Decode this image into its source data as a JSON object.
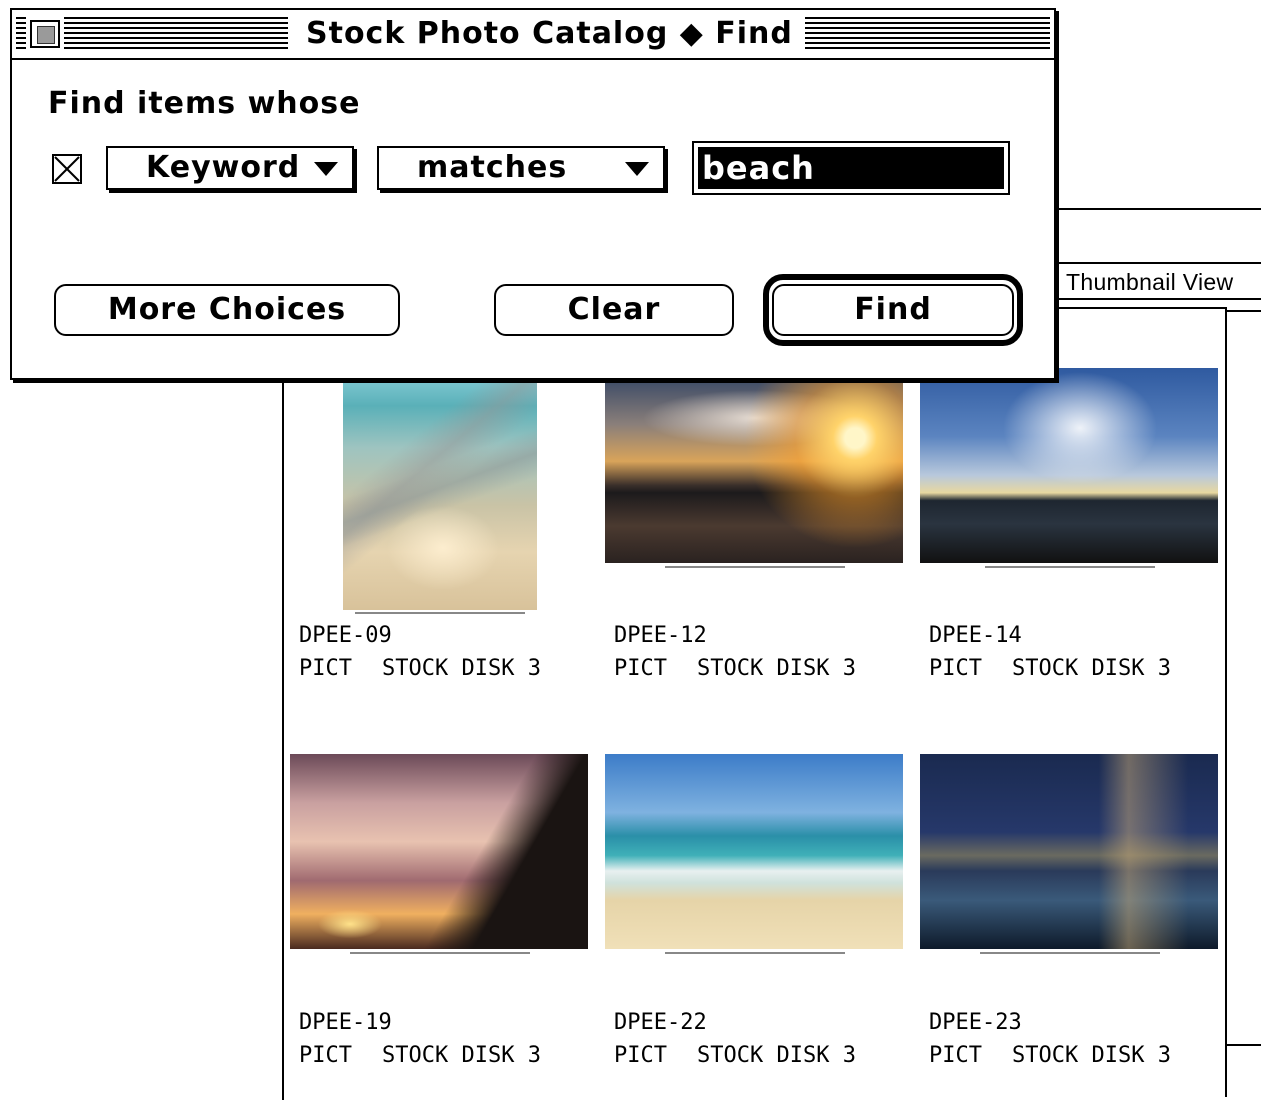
{
  "dialog": {
    "title": "Stock Photo Catalog ◆ Find",
    "find_label": "Find items whose",
    "criteria": {
      "enabled": true,
      "field": "Keyword",
      "operator": "matches",
      "value": "beach"
    },
    "buttons": {
      "more_choices": "More Choices",
      "clear": "Clear",
      "find": "Find"
    }
  },
  "catalog": {
    "view_tab": "Thumbnail View",
    "items": [
      {
        "id": "DPEE-09",
        "type": "PICT",
        "disk": "STOCK DISK 3"
      },
      {
        "id": "DPEE-12",
        "type": "PICT",
        "disk": "STOCK DISK 3"
      },
      {
        "id": "DPEE-14",
        "type": "PICT",
        "disk": "STOCK DISK 3"
      },
      {
        "id": "DPEE-19",
        "type": "PICT",
        "disk": "STOCK DISK 3"
      },
      {
        "id": "DPEE-22",
        "type": "PICT",
        "disk": "STOCK DISK 3"
      },
      {
        "id": "DPEE-23",
        "type": "PICT",
        "disk": "STOCK DISK 3"
      }
    ]
  }
}
